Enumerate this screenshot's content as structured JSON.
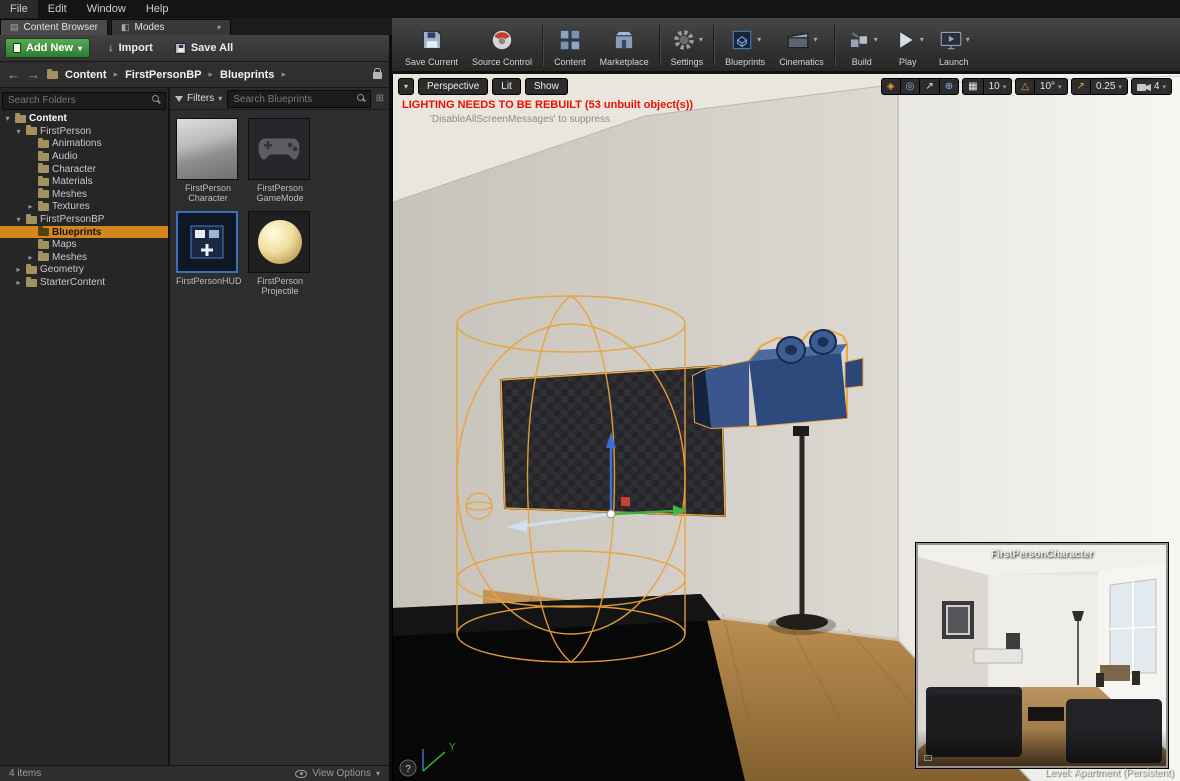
{
  "menubar": {
    "items": [
      "File",
      "Edit",
      "Window",
      "Help"
    ]
  },
  "tabs": {
    "content_browser": "Content Browser",
    "modes": "Modes"
  },
  "icons": {
    "caret_down": "▾",
    "caret_right": "▸",
    "back": "←",
    "forward": "→",
    "down_arrow": "↓",
    "grid": "▦",
    "angle": "△",
    "globe": "⊕",
    "maximize": "↗",
    "scale": "↗",
    "surface_snap": "◈",
    "rotation": "◎",
    "question": "?",
    "tab_cb": "▤",
    "tab_modes": "◧",
    "filter_save": "⊞"
  },
  "content_browser": {
    "toolbar": {
      "add_new": "Add New",
      "import": "Import",
      "save_all": "Save All"
    },
    "breadcrumb": [
      "Content",
      "FirstPersonBP",
      "Blueprints"
    ],
    "folder_search_placeholder": "Search Folders",
    "filters": "Filters",
    "asset_search_placeholder": "Search Blueprints",
    "tree": [
      {
        "label": "Content",
        "arrow": "▾"
      },
      {
        "label": "FirstPerson",
        "arrow": "▾"
      },
      {
        "label": "Animations",
        "arrow": ""
      },
      {
        "label": "Audio",
        "arrow": ""
      },
      {
        "label": "Character",
        "arrow": ""
      },
      {
        "label": "Materials",
        "arrow": ""
      },
      {
        "label": "Meshes",
        "arrow": ""
      },
      {
        "label": "Textures",
        "arrow": "▸"
      },
      {
        "label": "FirstPersonBP",
        "arrow": "▾"
      },
      {
        "label": "Blueprints",
        "arrow": ""
      },
      {
        "label": "Maps",
        "arrow": ""
      },
      {
        "label": "Meshes",
        "arrow": "▸"
      },
      {
        "label": "Geometry",
        "arrow": "▸"
      },
      {
        "label": "StarterContent",
        "arrow": "▸"
      }
    ],
    "assets": [
      {
        "line1": "FirstPerson",
        "line2": "Character"
      },
      {
        "line1": "FirstPerson",
        "line2": "GameMode"
      },
      {
        "line1": "FirstPersonHUD",
        "line2": ""
      },
      {
        "line1": "FirstPerson",
        "line2": "Projectile"
      }
    ],
    "status": {
      "count": "4 items",
      "view_options": "View Options"
    }
  },
  "main_toolbar": {
    "buttons": [
      {
        "label": "Save Current"
      },
      {
        "label": "Source Control"
      },
      {
        "label": "Content"
      },
      {
        "label": "Marketplace"
      },
      {
        "label": "Settings"
      },
      {
        "label": "Blueprints"
      },
      {
        "label": "Cinematics"
      },
      {
        "label": "Build"
      },
      {
        "label": "Play"
      },
      {
        "label": "Launch"
      }
    ]
  },
  "viewport": {
    "controls": {
      "perspective": "Perspective",
      "lit": "Lit",
      "show": "Show"
    },
    "snaps": {
      "grid": "10",
      "angle": "10°",
      "scale": "0.25",
      "camera": "4"
    },
    "warning": {
      "title": "LIGHTING NEEDS TO BE REBUILT (53 unbuilt object(s))",
      "subtitle": "'DisableAllScreenMessages' to suppress"
    },
    "pip_label": "FirstPersonCharacter",
    "level_label": "Level:  Apartment (Persistent)",
    "axis_y": "Y"
  },
  "colors": {
    "selection_orange": "#d4871e",
    "warning_red": "#e81000",
    "wire_orange": "#eaa23c",
    "gizmo_blue": "#3f6fd0",
    "gizmo_green": "#3fae3f",
    "add_new_green": "#3f8f3f"
  }
}
